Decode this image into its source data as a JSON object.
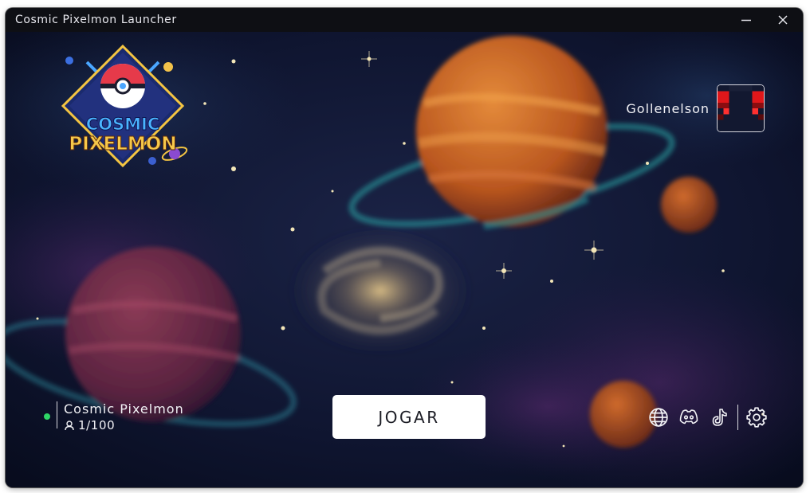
{
  "window": {
    "title": "Cosmic Pixelmon Launcher"
  },
  "logo": {
    "line1": "COSMIC",
    "line2": "PIXELMON"
  },
  "user": {
    "name": "Gollenelson"
  },
  "server": {
    "name": "Cosmic Pixelmon",
    "players": "1/100",
    "status_color": "#2ed566"
  },
  "play": {
    "label": "JOGAR"
  },
  "icons": {
    "minimize": "minimize-icon",
    "close": "close-icon",
    "website": "globe-icon",
    "discord": "discord-icon",
    "tiktok": "tiktok-icon",
    "settings": "gear-icon",
    "players": "user-icon"
  },
  "colors": {
    "titlebar": "#0e0f14",
    "background": "#0b1024",
    "button": "#ffffff"
  }
}
